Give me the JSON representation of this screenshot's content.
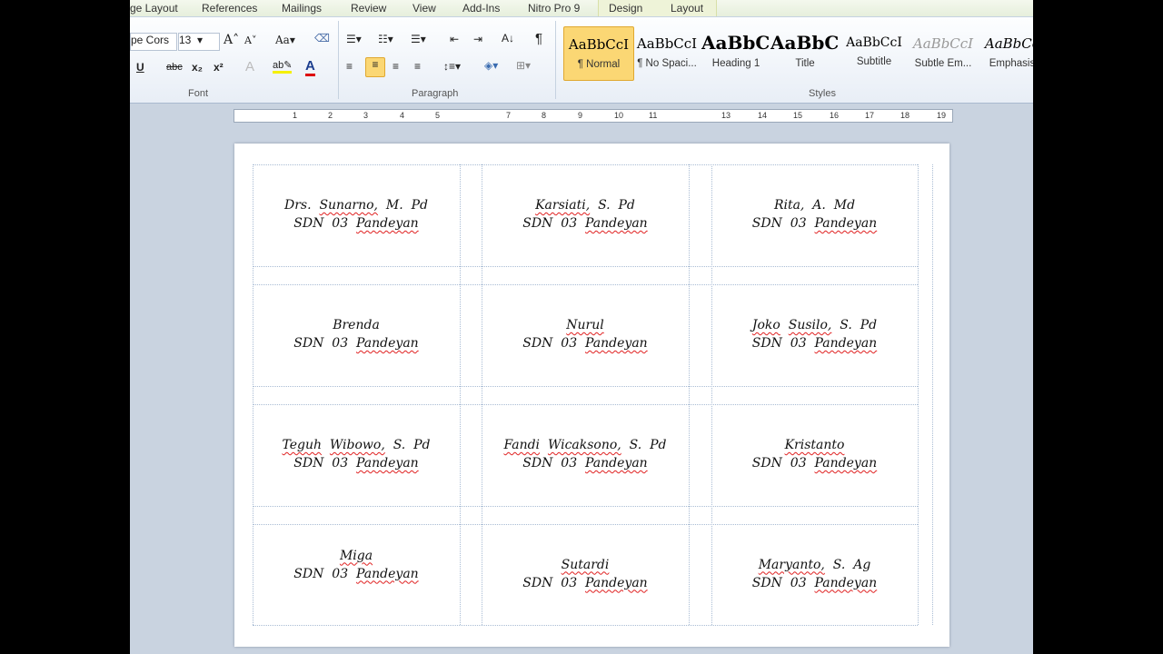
{
  "tabs": [
    "ge Layout",
    "References",
    "Mailings",
    "Review",
    "View",
    "Add-Ins",
    "Nitro Pro 9",
    "Design",
    "Layout"
  ],
  "font": {
    "name": "pe Cors",
    "size": "13",
    "group_label": "Font"
  },
  "paragraph": {
    "group_label": "Paragraph"
  },
  "styles": {
    "group_label": "Styles",
    "items": [
      {
        "preview": "AaBbCcI",
        "name": "¶ Normal"
      },
      {
        "preview": "AaBbCcI",
        "name": "¶ No Spaci..."
      },
      {
        "preview": "AaBbC(",
        "name": "Heading 1"
      },
      {
        "preview": "AaBbC(",
        "name": "Title"
      },
      {
        "preview": "AaBbCcI",
        "name": "Subtitle"
      },
      {
        "preview": "AaBbCcI",
        "name": "Subtle Em..."
      },
      {
        "preview": "AaBbCc",
        "name": "Emphasis"
      }
    ]
  },
  "ruler": [
    "1",
    "2",
    "3",
    "4",
    "5",
    "7",
    "8",
    "9",
    "10",
    "11",
    "13",
    "14",
    "15",
    "16",
    "17",
    "18",
    "19"
  ],
  "document": {
    "flagged": [
      "Sunarno,",
      "Karsiati,",
      "Pandeyan",
      "Joko",
      "Susilo,",
      "Teguh",
      "Wibowo,",
      "Fandi",
      "Wicaksono,",
      "Kristanto",
      "Miga",
      "Sutardi",
      "Maryanto,",
      "Nurul"
    ],
    "labels": [
      [
        "Drs. Sunarno, M. Pd",
        "SDN 03 Pandeyan"
      ],
      [
        "Karsiati, S. Pd",
        "SDN 03 Pandeyan"
      ],
      [
        "Rita, A. Md",
        "SDN 03 Pandeyan"
      ],
      [
        "Brenda",
        "SDN 03 Pandeyan"
      ],
      [
        "Nurul",
        "SDN 03 Pandeyan"
      ],
      [
        "Joko Susilo, S. Pd",
        "SDN 03 Pandeyan"
      ],
      [
        "Teguh Wibowo, S. Pd",
        "SDN 03 Pandeyan"
      ],
      [
        "Fandi Wicaksono, S. Pd",
        "SDN 03 Pandeyan"
      ],
      [
        "Kristanto",
        "SDN 03 Pandeyan"
      ],
      [
        "Miga",
        "SDN 03 Pandeyan"
      ],
      [
        "Sutardi",
        "SDN 03 Pandeyan"
      ],
      [
        "Maryanto, S. Ag",
        "SDN 03 Pandeyan"
      ]
    ]
  }
}
